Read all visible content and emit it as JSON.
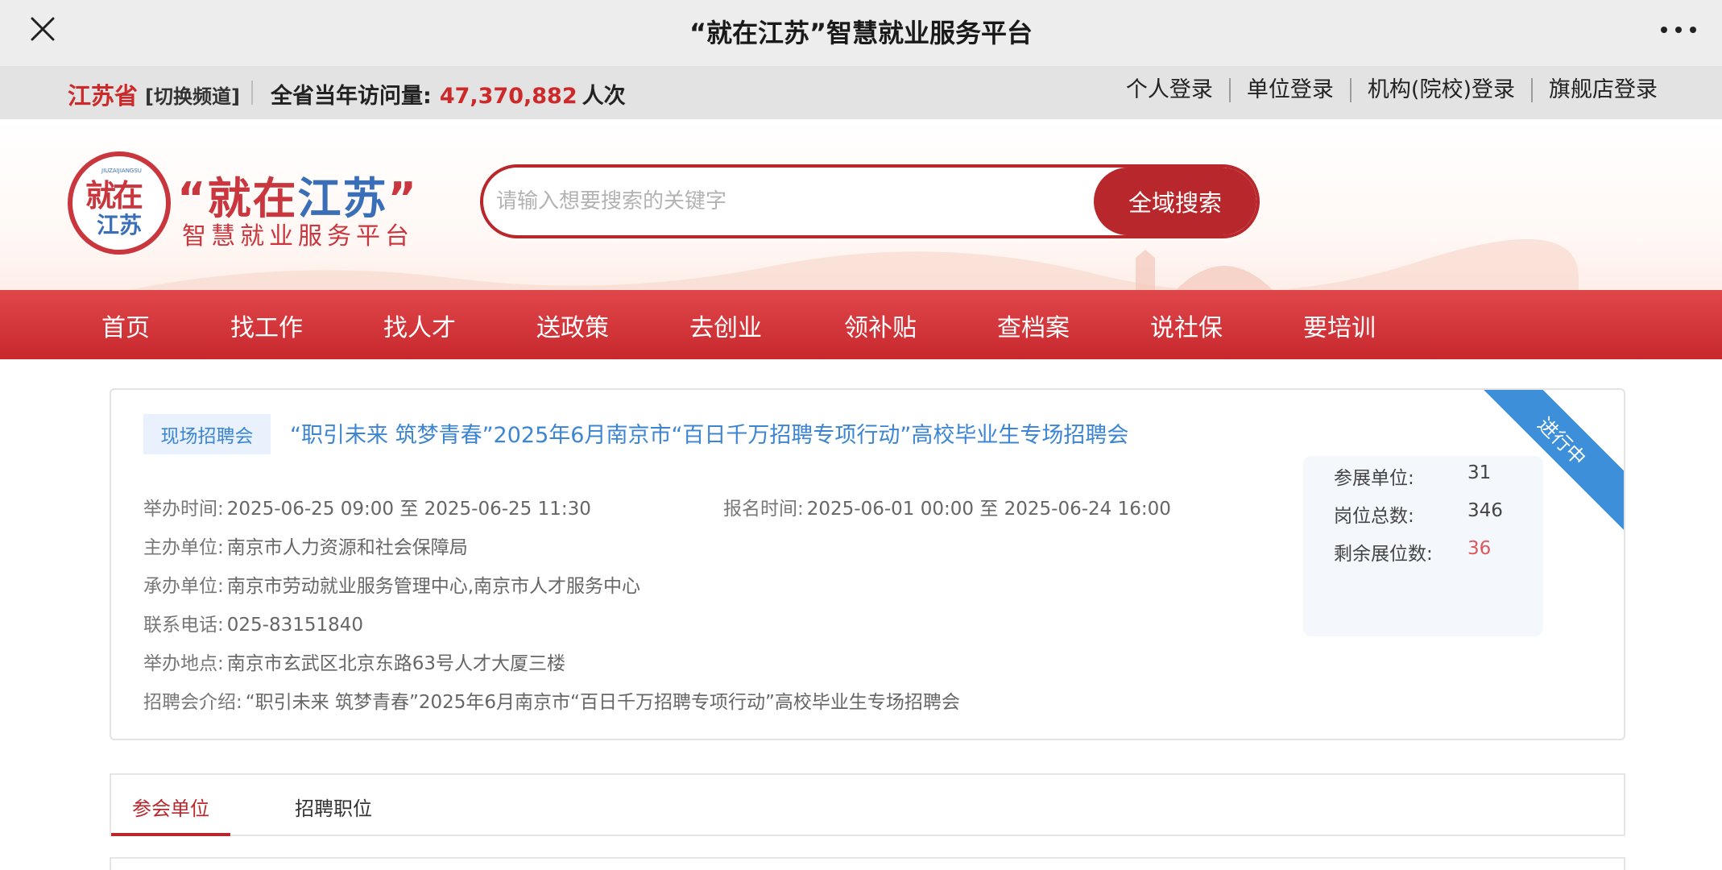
{
  "appbar": {
    "title": "“就在江苏”智慧就业服务平台",
    "close_icon": "close-icon",
    "more_icon": "more-dots-icon"
  },
  "topbar": {
    "province": "江苏省",
    "switch_channel": "[切换频道]",
    "visits_label": "全省当年访问量:",
    "visits_count": "47,370,882",
    "visits_unit": "人次",
    "logins": [
      "个人登录",
      "单位登录",
      "机构(院校)登录",
      "旗舰店登录"
    ]
  },
  "brand": {
    "logo_line1": "就在",
    "logo_line2": "江苏",
    "logo_tiny": "JIUZAIJIANGSU",
    "quote_open": "“",
    "title_red": "就在",
    "title_blue": "江苏",
    "quote_close": "”",
    "subtitle": "智慧就业服务平台"
  },
  "search": {
    "placeholder": "请输入想要搜索的关键字",
    "button": "全域搜索"
  },
  "nav": [
    "首页",
    "找工作",
    "找人才",
    "送政策",
    "去创业",
    "领补贴",
    "查档案",
    "说社保",
    "要培训"
  ],
  "fair": {
    "tag": "现场招聘会",
    "title": "“职引未来 筑梦青春”2025年6月南京市“百日千万招聘专项行动”高校毕业生专场招聘会",
    "status": "进行中",
    "hold_time_label": "举办时间:",
    "hold_time": "2025-06-25 09:00 至 2025-06-25 11:30",
    "signup_time_label": "报名时间:",
    "signup_time": "2025-06-01 00:00 至 2025-06-24 16:00",
    "host_label": "主办单位:",
    "host": "南京市人力资源和社会保障局",
    "organizer_label": "承办单位:",
    "organizer": "南京市劳动就业服务管理中心,南京市人才服务中心",
    "phone_label": "联系电话:",
    "phone": "025-83151840",
    "place_label": "举办地点:",
    "place": "南京市玄武区北京东路63号人才大厦三楼",
    "intro_label": "招聘会介绍:",
    "intro": "“职引未来 筑梦青春”2025年6月南京市“百日千万招聘专项行动”高校毕业生专场招聘会",
    "stats": {
      "exhibitors_label": "参展单位:",
      "exhibitors": "31",
      "positions_label": "岗位总数:",
      "positions": "346",
      "remaining_label": "剩余展位数:",
      "remaining": "36"
    }
  },
  "tabs": {
    "active": "参会单位",
    "other": "招聘职位"
  },
  "colors": {
    "brand_red": "#b8272b",
    "brand_blue": "#3a6fb8",
    "link_blue": "#3c85d2",
    "status_blue": "#3d8fd9"
  }
}
